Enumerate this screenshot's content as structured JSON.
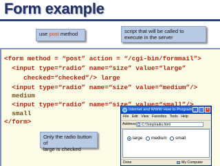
{
  "slide": {
    "title": "Form example",
    "callouts": {
      "post_prefix": "use ",
      "post_keyword": "post",
      "post_suffix": " method",
      "script_line1": "script that will be called to",
      "script_line2": "execute in the server",
      "radio_line1": "Only the radio button of",
      "radio_line2": "large is checked"
    }
  },
  "code": {
    "lines": [
      "<form method = “post” action = “/cgi-bin/formmail”>",
      "  <input type=“radio” name=“size” value=“large”",
      "     checked=“checked”/> large",
      "  <input type=“radio” name=“size” value=“medium”/>",
      "  medium",
      "  <input type=“radio” name=“size” value=“small”/>",
      "  small",
      "</form>"
    ]
  },
  "browser": {
    "title": "Internet and WWW How to Program -...",
    "menu": [
      "File",
      "Edit",
      "View",
      "Favorites",
      "Tools",
      "Help"
    ],
    "address_label": "Address",
    "address_value": "C:\\Temp\\radio.html",
    "radios": [
      {
        "label": "large",
        "checked": true
      },
      {
        "label": "medium",
        "checked": false
      },
      {
        "label": "small",
        "checked": false
      }
    ],
    "status_done": "Done",
    "status_zone": "My Computer",
    "colors": {
      "titlebar": "#0a55d8",
      "close": "#d9401a"
    }
  },
  "colors": {
    "title": "#24305e",
    "code_tag": "#b8220f",
    "code_text": "#7a4e16",
    "callout_bg": "#b9cbe4",
    "panel_bg": "#fbfbe6"
  }
}
